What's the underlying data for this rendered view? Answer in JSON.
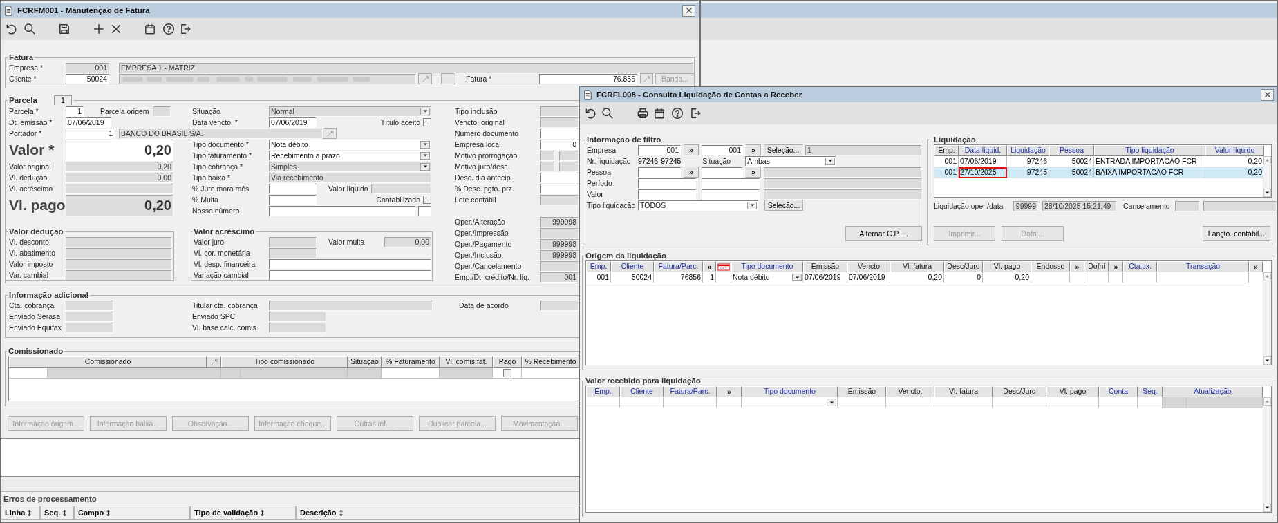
{
  "invoice_window": {
    "title": "FCRFM001 - Manutenção de Fatura",
    "fatura": {
      "title": "Fatura",
      "empresa": {
        "label": "Empresa *",
        "code": {
          "value": "001",
          "disabled": true
        },
        "name": {
          "value": "EMPRESA 1 - MATRIZ",
          "disabled": true
        }
      },
      "cliente": {
        "label": "Cliente *",
        "code": {
          "value": "50024",
          "disabled": false
        },
        "name": {
          "disabled": true,
          "redacted": true
        }
      },
      "fatura": {
        "label": "Fatura *",
        "value": "76.856",
        "disabled": false
      },
      "banda_button": {
        "label": "Banda...",
        "disabled": true
      }
    },
    "parcela": {
      "title": "Parcela",
      "tab": "1",
      "left_column": [
        {
          "label": "Parcela *",
          "kind": "field",
          "value": "1",
          "disabled": false,
          "extra": {
            "kind": "field",
            "label": "Parcela origem",
            "disabled": true
          }
        },
        {
          "label": "Dt. emissão *",
          "kind": "field",
          "value": "07/06/2019",
          "disabled": false
        },
        {
          "label": "Portador *",
          "kind": "lookup",
          "value": "1",
          "disabled": false,
          "name": {
            "value": "BANCO DO BRASIL S/A.",
            "disabled": true
          }
        },
        {
          "label": "Valor *",
          "kind": "big",
          "value": "0,20",
          "disabled": false
        },
        {
          "label": "Valor original",
          "kind": "field",
          "value": "0,20",
          "disabled": true
        },
        {
          "label": "Vl. dedução",
          "kind": "field",
          "value": "0,00",
          "disabled": true
        },
        {
          "label": "Vl. acréscimo",
          "kind": "field",
          "disabled": true
        },
        {
          "label": "Vl. pago",
          "kind": "big",
          "value": "0,20",
          "disabled": true
        }
      ],
      "middle_column": [
        {
          "label": "Situação",
          "kind": "combo",
          "value": "Normal",
          "disabled": true
        },
        {
          "label": "Data vencto. *",
          "kind": "field",
          "value": "07/06/2019",
          "disabled": false,
          "extra": {
            "kind": "check",
            "label": "Título aceito",
            "checked": false
          }
        },
        {
          "label": "Tipo documento *",
          "kind": "combo",
          "value": "Nota débito",
          "disabled": false
        },
        {
          "label": "Tipo faturamento *",
          "kind": "combo",
          "value": "Recebimento a prazo",
          "disabled": false
        },
        {
          "label": "Tipo cobrança *",
          "kind": "combo",
          "value": "Simples",
          "disabled": true
        },
        {
          "label": "Tipo baixa *",
          "kind": "field",
          "value": "Via recebimento",
          "disabled": true
        },
        {
          "label": "% Juro mora mês",
          "kind": "field",
          "disabled": false,
          "extra": {
            "kind": "field",
            "label": "Valor líquido",
            "disabled": true
          }
        },
        {
          "label": "% Multa",
          "kind": "field",
          "disabled": false,
          "extra": {
            "kind": "check",
            "label": "Contabilizado",
            "checked": false
          }
        },
        {
          "label": "Nosso número",
          "kind": "field",
          "disabled": false,
          "extra": {
            "kind": "field",
            "disabled": false
          }
        }
      ],
      "right_column": [
        {
          "label": "Tipo inclusão",
          "kind": "field",
          "disabled": true
        },
        {
          "label": "Vencto. original",
          "kind": "field",
          "disabled": true
        },
        {
          "label": "Número documento",
          "kind": "field",
          "disabled": false
        },
        {
          "label": "Empresa local",
          "kind": "field",
          "value": "0",
          "disabled": false
        },
        {
          "label": "Motivo prorrogação",
          "kind": "pair",
          "disabled": true
        },
        {
          "label": "Motivo juro/desc.",
          "kind": "pair",
          "disabled": true
        },
        {
          "label": "Desc. dia antecip.",
          "kind": "field",
          "disabled": false
        },
        {
          "label": "% Desc. pgto. prz.",
          "kind": "field",
          "disabled": false
        },
        {
          "label": "Lote contábil",
          "kind": "field",
          "disabled": true
        },
        {
          "label": "Oper./Alteração",
          "kind": "field",
          "value": "999998",
          "disabled": true
        },
        {
          "label": "Oper./Impressão",
          "kind": "field",
          "disabled": true
        },
        {
          "label": "Oper./Pagamento",
          "kind": "field",
          "value": "999998",
          "disabled": true
        },
        {
          "label": "Oper./Inclusão",
          "kind": "field",
          "value": "999998",
          "disabled": true
        },
        {
          "label": "Oper./Cancelamento",
          "kind": "field",
          "disabled": true
        },
        {
          "label": "Emp./Dt. crédito/Nr. liq.",
          "kind": "field",
          "value": "001",
          "disabled": true
        }
      ],
      "valor_deducao": {
        "title": "Valor dedução",
        "rows": [
          {
            "label": "Vl. desconto",
            "disabled": true
          },
          {
            "label": "Vl. abatimento",
            "disabled": true
          },
          {
            "label": "Valor imposto",
            "disabled": true
          },
          {
            "label": "Var. cambial",
            "disabled": true
          }
        ]
      },
      "valor_acrescimo": {
        "title": "Valor acréscimo",
        "rows": [
          {
            "label": "Valor juro",
            "disabled": true,
            "extra": {
              "kind": "field",
              "label": "Valor multa",
              "value": "0,00",
              "disabled": true
            }
          },
          {
            "label": "Vl. cor. monetária",
            "disabled": true
          },
          {
            "label": "Vl. desp. financeira",
            "disabled": false
          },
          {
            "label": "Variação cambial",
            "disabled": false
          }
        ]
      }
    },
    "informacao_adicional": {
      "title": "Informação adicional",
      "columns": [
        [
          {
            "label": "Cta. cobrança",
            "disabled": true
          },
          {
            "label": "Enviado Serasa",
            "disabled": true
          },
          {
            "label": "Enviado Equifax",
            "disabled": true
          }
        ],
        [
          {
            "label": "Titular cta. cobrança",
            "disabled": true
          },
          {
            "label": "Enviado SPC",
            "disabled": true
          },
          {
            "label": "Vl. base calc. comis.",
            "disabled": true
          }
        ],
        [
          {
            "label": "Data de acordo",
            "disabled": true
          }
        ]
      ]
    },
    "comissionado": {
      "title": "Comissionado",
      "columns": [
        {
          "label": "Comissionado"
        },
        {
          "kind": "icon"
        },
        {
          "label": "Tipo comissionado"
        },
        {
          "label": "Situação"
        },
        {
          "label": "% Faturamento"
        },
        {
          "label": "Vl. comis.fat."
        },
        {
          "label": "Pago"
        },
        {
          "label": "% Recebimento"
        }
      ],
      "rows": [
        {
          "cells": [
            {
              "disabled": false
            },
            {
              "disabled": true
            },
            {
              "disabled": true
            },
            {
              "disabled": true
            },
            {
              "disabled": true
            },
            {
              "disabled": false
            },
            {
              "disabled": true
            },
            {
              "kind": "check",
              "checked": false
            },
            {
              "disabled": false
            }
          ]
        }
      ]
    },
    "buttons": [
      {
        "label": "Informação origem...",
        "disabled": true
      },
      {
        "label": "Informação baixa...",
        "disabled": true
      },
      {
        "label": "Observação...",
        "disabled": true
      },
      {
        "label": "Informação cheque...",
        "disabled": true
      },
      {
        "label": "Outras inf. ...",
        "disabled": true
      },
      {
        "label": "Duplicar parcela...",
        "disabled": true
      },
      {
        "label": "Movimentação...",
        "disabled": true
      }
    ],
    "erros": {
      "title": "Erros de processamento",
      "columns": [
        "Linha",
        "Seq.",
        "Campo",
        "Tipo de validação",
        "Descrição"
      ]
    }
  },
  "query_window": {
    "title": "FCRFL008 - Consulta Liquidação de Contas a Receber",
    "filtro": {
      "title": "Informação de filtro",
      "rows": [
        {
          "label": "Empresa",
          "items": [
            {
              "kind": "field",
              "value": "001",
              "disabled": false
            },
            {
              "kind": "more",
              "label": "»"
            },
            {
              "kind": "field",
              "value": "001",
              "disabled": false
            },
            {
              "kind": "more",
              "label": "»"
            },
            {
              "kind": "button",
              "label": "Seleção..."
            },
            {
              "kind": "field",
              "value": "1",
              "disabled": true
            }
          ]
        },
        {
          "label": "Nr. liquidação",
          "items": [
            {
              "kind": "text",
              "value": "97246"
            },
            {
              "kind": "text",
              "value": "97245"
            },
            {
              "kind": "label",
              "label": "Situação"
            },
            {
              "kind": "combo",
              "value": "Ambas",
              "disabled": false
            }
          ]
        },
        {
          "label": "Pessoa",
          "items": [
            {
              "kind": "field",
              "disabled": false
            },
            {
              "kind": "more",
              "label": "»"
            },
            {
              "kind": "field",
              "disabled": false
            },
            {
              "kind": "more",
              "label": "»"
            },
            {
              "kind": "field",
              "disabled": true
            }
          ]
        },
        {
          "label": "Período",
          "items": [
            {
              "kind": "field",
              "disabled": false
            },
            {
              "kind": "field",
              "disabled": false
            },
            {
              "kind": "field",
              "disabled": true
            }
          ]
        },
        {
          "label": "Valor",
          "items": [
            {
              "kind": "field",
              "disabled": false
            },
            {
              "kind": "field",
              "disabled": false
            },
            {
              "kind": "field",
              "disabled": true
            }
          ]
        },
        {
          "label": "Tipo liquidação",
          "items": [
            {
              "kind": "combo",
              "value": "TODOS",
              "disabled": false
            },
            {
              "kind": "button",
              "label": "Seleção..."
            }
          ]
        }
      ],
      "alternar_button": {
        "label": "Alternar C.P. ..."
      }
    },
    "liquidacao": {
      "title": "Liquidação",
      "columns": [
        {
          "label": "Emp.",
          "linked": false
        },
        {
          "label": "Data liquid.",
          "linked": true
        },
        {
          "label": "Liquidação",
          "linked": true
        },
        {
          "label": "Pessoa",
          "linked": true
        },
        {
          "label": "Tipo liquidação",
          "linked": true
        },
        {
          "label": "Valor líquido",
          "linked": true
        }
      ],
      "rows": [
        {
          "selected": false,
          "focused": false,
          "cells": [
            "001",
            "07/06/2019",
            "97246",
            "50024",
            "ENTRADA IMPORTACAO FCR",
            "0,20"
          ]
        },
        {
          "selected": true,
          "focused": true,
          "cells": [
            "001",
            "27/10/2025",
            "97245",
            "50024",
            "BAIXA IMPORTACAO FCR",
            "0,20"
          ]
        }
      ],
      "oper": {
        "label": "Liquidação oper./data",
        "operator": {
          "value": "99999",
          "disabled": true
        },
        "date": {
          "value": "28/10/2025 15:21:49",
          "disabled": true
        },
        "cancel_label": "Cancelamento",
        "cancel_operator": {
          "disabled": true
        },
        "cancel_date": {
          "disabled": true
        }
      },
      "buttons": [
        {
          "label": "Imprimir...",
          "disabled": true
        },
        {
          "label": "Dofni...",
          "disabled": true
        },
        {
          "label": "Lançto. contábil...",
          "disabled": false
        }
      ]
    },
    "origem": {
      "title": "Origem da liquidação",
      "columns": [
        {
          "label": "Emp.",
          "linked": true
        },
        {
          "label": "Cliente",
          "linked": true
        },
        {
          "label": "Fatura/Parc.",
          "linked": true
        },
        {
          "kind": "more",
          "label": "»"
        },
        {
          "kind": "icon"
        },
        {
          "label": "Tipo documento",
          "linked": true
        },
        {
          "label": "Emissão",
          "linked": false
        },
        {
          "label": "Vencto",
          "linked": false
        },
        {
          "label": "Vl. fatura",
          "linked": false
        },
        {
          "label": "Desc/Juro",
          "linked": false
        },
        {
          "label": "Vl. pago",
          "linked": false
        },
        {
          "label": "Endosso",
          "linked": false
        },
        {
          "kind": "more",
          "label": "»"
        },
        {
          "label": "Dofni",
          "linked": false
        },
        {
          "kind": "more",
          "label": "»"
        },
        {
          "label": "Cta.cx.",
          "linked": true
        },
        {
          "label": "Transação",
          "linked": true
        },
        {
          "kind": "more",
          "label": "»"
        }
      ],
      "rows": [
        {
          "cells": [
            {
              "value": "001"
            },
            {
              "value": "50024"
            },
            {
              "value": "76856"
            },
            {
              "value": "1"
            },
            {
              "disabled": false
            },
            {
              "kind": "combo",
              "value": "Nota débito",
              "disabled": false
            },
            {
              "value": "07/06/2019"
            },
            {
              "value": "07/06/2019"
            },
            {
              "value": "0,20"
            },
            {
              "value": "0"
            },
            {
              "value": "0,20"
            },
            {
              "disabled": false
            },
            {
              "disabled": false
            },
            {
              "disabled": false
            },
            {
              "disabled": false
            },
            {
              "disabled": false
            },
            {
              "disabled": false
            }
          ]
        }
      ]
    },
    "valor_recebido": {
      "title": "Valor recebido para liquidação",
      "columns": [
        {
          "label": "Emp.",
          "linked": true
        },
        {
          "label": "Cliente",
          "linked": true
        },
        {
          "label": "Fatura/Parc.",
          "linked": true
        },
        {
          "kind": "more",
          "label": "»"
        },
        {
          "label": "Tipo documento",
          "linked": true
        },
        {
          "label": "Emissão",
          "linked": false
        },
        {
          "label": "Vencto.",
          "linked": false
        },
        {
          "label": "Vl. fatura",
          "linked": false
        },
        {
          "label": "Desc/Juro",
          "linked": false
        },
        {
          "label": "Vl. pago",
          "linked": false
        },
        {
          "label": "Conta",
          "linked": true
        },
        {
          "label": "Seq.",
          "linked": true
        },
        {
          "label": "Atualização",
          "linked": true
        }
      ],
      "rows": [
        {
          "cells": [
            {
              "disabled": false
            },
            {
              "disabled": false
            },
            {
              "disabled": false
            },
            {
              "disabled": false
            },
            {
              "kind": "combo",
              "disabled": false
            },
            {
              "disabled": false
            },
            {
              "disabled": false
            },
            {
              "disabled": false
            },
            {
              "disabled": false
            },
            {
              "disabled": false
            },
            {
              "disabled": false
            },
            {
              "disabled": false
            },
            {
              "disabled": true
            },
            {
              "disabled": true
            }
          ]
        }
      ]
    }
  }
}
